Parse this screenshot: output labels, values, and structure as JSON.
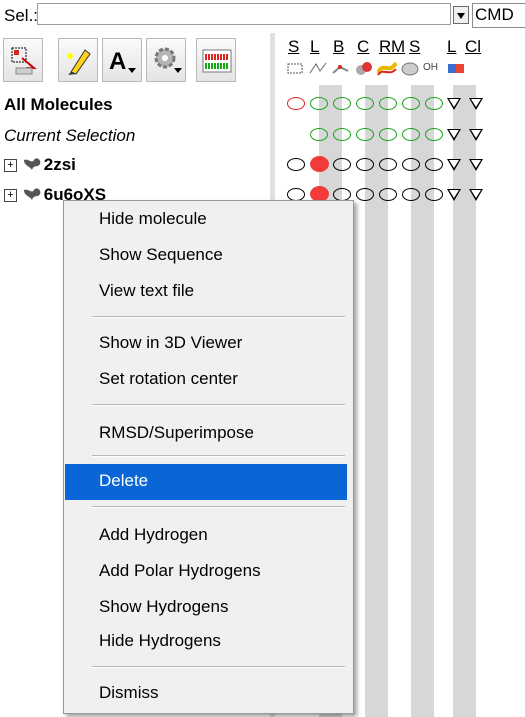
{
  "selection_bar": {
    "label": "Sel.:",
    "input_value": "",
    "cmd_label": "CMD"
  },
  "toolbar": {
    "buttons": [
      {
        "name": "select-tool"
      },
      {
        "name": "pencil-tool"
      },
      {
        "name": "label-tool",
        "text": "A"
      },
      {
        "name": "settings-tool"
      },
      {
        "name": "sequence-tool"
      }
    ]
  },
  "columns": {
    "headers": [
      "S",
      "L",
      "B",
      "C",
      "R",
      "M",
      "S",
      "L",
      "Cl"
    ],
    "icons": [
      "selection-box-icon",
      "line-icon",
      "stick-icon",
      "cpk-icon",
      "ribbon-icon",
      "surface-icon",
      "label-icon",
      "color-icon"
    ],
    "label_icon_text": "OH"
  },
  "tree": {
    "all_molecules": "All Molecules",
    "current_selection": "Current Selection",
    "molecules": [
      {
        "name": "2zsi"
      },
      {
        "name": "6u6oXS"
      }
    ]
  },
  "context_menu": {
    "items": [
      {
        "label": "Hide molecule"
      },
      {
        "label": "Show Sequence"
      },
      {
        "label": "View text file"
      },
      {
        "label": "Show in 3D Viewer"
      },
      {
        "label": "Set rotation center"
      },
      {
        "label": "RMSD/Superimpose"
      },
      {
        "label": "Delete"
      },
      {
        "label": "Add Hydrogen"
      },
      {
        "label": "Add Polar Hydrogens"
      },
      {
        "label": "Show Hydrogens"
      },
      {
        "label": "Hide Hydrogens"
      },
      {
        "label": "Dismiss"
      }
    ],
    "highlighted": "Delete"
  },
  "colors": {
    "highlight": "#0a66d6",
    "status_red": "#e0262a",
    "status_green": "#1aa51a",
    "column_shade": "#d7d7d7"
  }
}
